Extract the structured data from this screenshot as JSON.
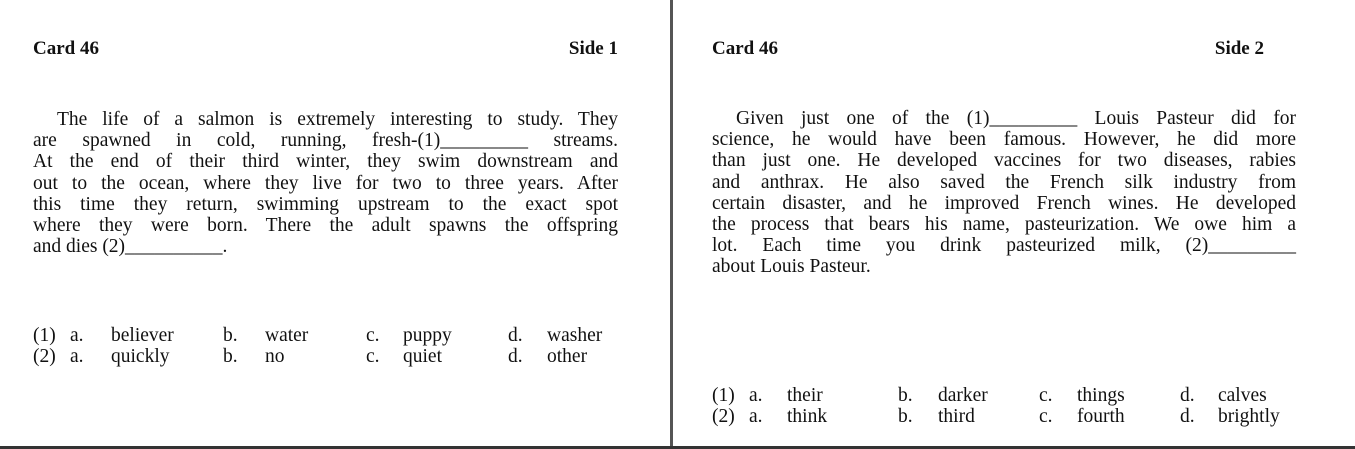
{
  "left": {
    "title": "Card 46",
    "side": "Side 1",
    "lines": [
      "The life of a salmon is extremely interesting to study. They",
      "are spawned in cold, running, fresh-(1)_________ streams.",
      "At the end of their third winter, they swim downstream and",
      "out to the ocean, where they live for two to three years. After",
      "this time they return, swimming upstream to the exact spot",
      "where they were born. There the adult spawns the offspring",
      "and dies (2)__________."
    ],
    "options": [
      {
        "num": "(1)",
        "a": "believer",
        "b": "water",
        "c": "puppy",
        "d": "washer"
      },
      {
        "num": "(2)",
        "a": "quickly",
        "b": "no",
        "c": "quiet",
        "d": "other"
      }
    ]
  },
  "right": {
    "title": "Card 46",
    "side": "Side 2",
    "lines": [
      "Given just one of the (1)_________ Louis Pasteur did for",
      "science, he would have been famous. However, he did more",
      "than just one. He developed vaccines for two diseases, rabies",
      "and anthrax. He also saved the French silk industry from",
      "certain disaster, and he improved French wines. He developed",
      "the process that bears his name, pasteurization. We owe him a",
      "lot. Each time you drink pasteurized milk, (2)_________",
      "about Louis Pasteur."
    ],
    "options": [
      {
        "num": "(1)",
        "a": "their",
        "b": "darker",
        "c": "things",
        "d": "calves"
      },
      {
        "num": "(2)",
        "a": "think",
        "b": "third",
        "c": "fourth",
        "d": "brightly"
      }
    ]
  },
  "labels": {
    "a": "a.",
    "b": "b.",
    "c": "c.",
    "d": "d."
  }
}
